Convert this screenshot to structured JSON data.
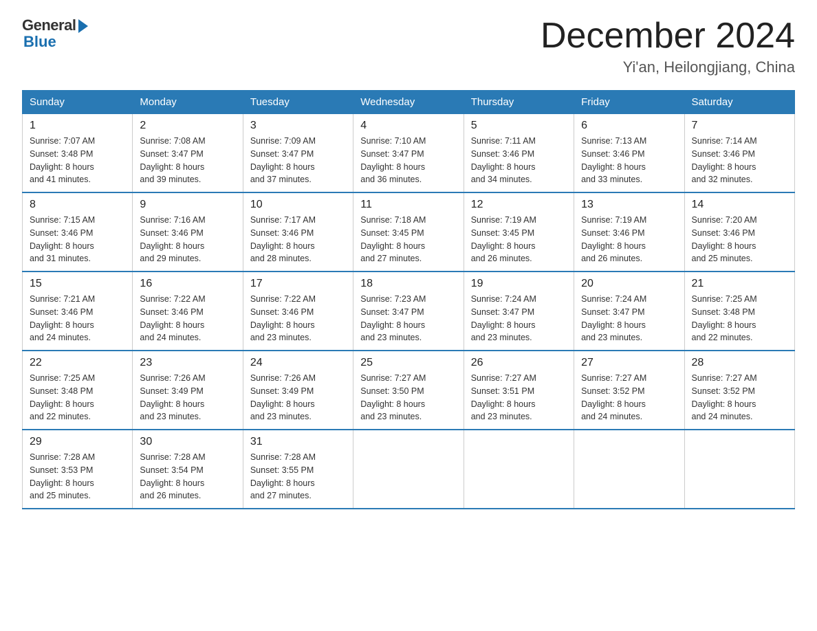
{
  "logo": {
    "general": "General",
    "blue": "Blue"
  },
  "title": {
    "month": "December 2024",
    "location": "Yi'an, Heilongjiang, China"
  },
  "headers": [
    "Sunday",
    "Monday",
    "Tuesday",
    "Wednesday",
    "Thursday",
    "Friday",
    "Saturday"
  ],
  "weeks": [
    [
      {
        "day": "1",
        "sunrise": "7:07 AM",
        "sunset": "3:48 PM",
        "daylight": "8 hours and 41 minutes."
      },
      {
        "day": "2",
        "sunrise": "7:08 AM",
        "sunset": "3:47 PM",
        "daylight": "8 hours and 39 minutes."
      },
      {
        "day": "3",
        "sunrise": "7:09 AM",
        "sunset": "3:47 PM",
        "daylight": "8 hours and 37 minutes."
      },
      {
        "day": "4",
        "sunrise": "7:10 AM",
        "sunset": "3:47 PM",
        "daylight": "8 hours and 36 minutes."
      },
      {
        "day": "5",
        "sunrise": "7:11 AM",
        "sunset": "3:46 PM",
        "daylight": "8 hours and 34 minutes."
      },
      {
        "day": "6",
        "sunrise": "7:13 AM",
        "sunset": "3:46 PM",
        "daylight": "8 hours and 33 minutes."
      },
      {
        "day": "7",
        "sunrise": "7:14 AM",
        "sunset": "3:46 PM",
        "daylight": "8 hours and 32 minutes."
      }
    ],
    [
      {
        "day": "8",
        "sunrise": "7:15 AM",
        "sunset": "3:46 PM",
        "daylight": "8 hours and 31 minutes."
      },
      {
        "day": "9",
        "sunrise": "7:16 AM",
        "sunset": "3:46 PM",
        "daylight": "8 hours and 29 minutes."
      },
      {
        "day": "10",
        "sunrise": "7:17 AM",
        "sunset": "3:46 PM",
        "daylight": "8 hours and 28 minutes."
      },
      {
        "day": "11",
        "sunrise": "7:18 AM",
        "sunset": "3:45 PM",
        "daylight": "8 hours and 27 minutes."
      },
      {
        "day": "12",
        "sunrise": "7:19 AM",
        "sunset": "3:45 PM",
        "daylight": "8 hours and 26 minutes."
      },
      {
        "day": "13",
        "sunrise": "7:19 AM",
        "sunset": "3:46 PM",
        "daylight": "8 hours and 26 minutes."
      },
      {
        "day": "14",
        "sunrise": "7:20 AM",
        "sunset": "3:46 PM",
        "daylight": "8 hours and 25 minutes."
      }
    ],
    [
      {
        "day": "15",
        "sunrise": "7:21 AM",
        "sunset": "3:46 PM",
        "daylight": "8 hours and 24 minutes."
      },
      {
        "day": "16",
        "sunrise": "7:22 AM",
        "sunset": "3:46 PM",
        "daylight": "8 hours and 24 minutes."
      },
      {
        "day": "17",
        "sunrise": "7:22 AM",
        "sunset": "3:46 PM",
        "daylight": "8 hours and 23 minutes."
      },
      {
        "day": "18",
        "sunrise": "7:23 AM",
        "sunset": "3:47 PM",
        "daylight": "8 hours and 23 minutes."
      },
      {
        "day": "19",
        "sunrise": "7:24 AM",
        "sunset": "3:47 PM",
        "daylight": "8 hours and 23 minutes."
      },
      {
        "day": "20",
        "sunrise": "7:24 AM",
        "sunset": "3:47 PM",
        "daylight": "8 hours and 23 minutes."
      },
      {
        "day": "21",
        "sunrise": "7:25 AM",
        "sunset": "3:48 PM",
        "daylight": "8 hours and 22 minutes."
      }
    ],
    [
      {
        "day": "22",
        "sunrise": "7:25 AM",
        "sunset": "3:48 PM",
        "daylight": "8 hours and 22 minutes."
      },
      {
        "day": "23",
        "sunrise": "7:26 AM",
        "sunset": "3:49 PM",
        "daylight": "8 hours and 23 minutes."
      },
      {
        "day": "24",
        "sunrise": "7:26 AM",
        "sunset": "3:49 PM",
        "daylight": "8 hours and 23 minutes."
      },
      {
        "day": "25",
        "sunrise": "7:27 AM",
        "sunset": "3:50 PM",
        "daylight": "8 hours and 23 minutes."
      },
      {
        "day": "26",
        "sunrise": "7:27 AM",
        "sunset": "3:51 PM",
        "daylight": "8 hours and 23 minutes."
      },
      {
        "day": "27",
        "sunrise": "7:27 AM",
        "sunset": "3:52 PM",
        "daylight": "8 hours and 24 minutes."
      },
      {
        "day": "28",
        "sunrise": "7:27 AM",
        "sunset": "3:52 PM",
        "daylight": "8 hours and 24 minutes."
      }
    ],
    [
      {
        "day": "29",
        "sunrise": "7:28 AM",
        "sunset": "3:53 PM",
        "daylight": "8 hours and 25 minutes."
      },
      {
        "day": "30",
        "sunrise": "7:28 AM",
        "sunset": "3:54 PM",
        "daylight": "8 hours and 26 minutes."
      },
      {
        "day": "31",
        "sunrise": "7:28 AM",
        "sunset": "3:55 PM",
        "daylight": "8 hours and 27 minutes."
      },
      null,
      null,
      null,
      null
    ]
  ],
  "labels": {
    "sunrise": "Sunrise:",
    "sunset": "Sunset:",
    "daylight": "Daylight:"
  }
}
